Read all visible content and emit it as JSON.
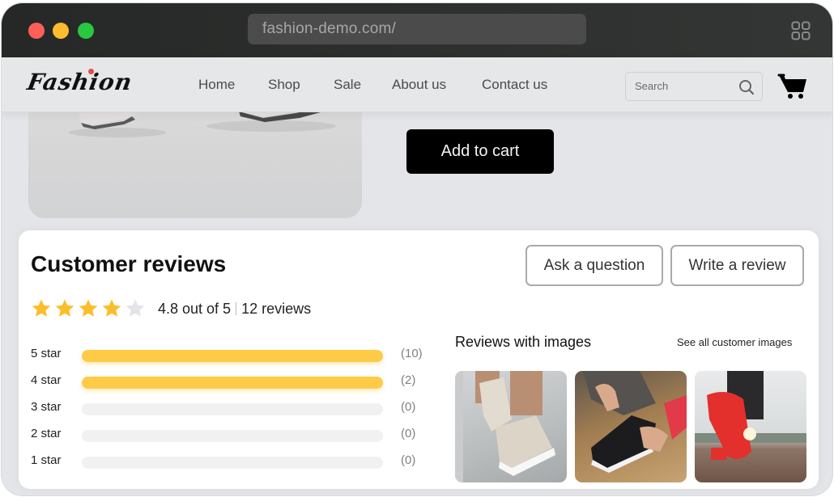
{
  "browser": {
    "url": "fashion-demo.com/",
    "traffic_lights": [
      "close",
      "minimize",
      "maximize"
    ],
    "tabs_icon": "grid-icon"
  },
  "nav": {
    "logo": "Fashion",
    "links": [
      "Home",
      "Shop",
      "Sale",
      "About us",
      "Contact us"
    ],
    "search_placeholder": "Search",
    "search_icon": "search-icon",
    "cart_icon": "cart-icon"
  },
  "product": {
    "add_to_cart_label": "Add to cart"
  },
  "reviews": {
    "title": "Customer reviews",
    "ask_question_label": "Ask a question",
    "write_review_label": "Write a review",
    "rating": 4.8,
    "stars_filled": 4,
    "stars_total": 5,
    "rating_text": "4.8 out of 5",
    "review_count_text": "12 reviews",
    "accent_color": "#fecb47",
    "distribution": [
      {
        "label": "5 star",
        "count_text": "(10)",
        "fill_percent": 100
      },
      {
        "label": "4 star",
        "count_text": "(2)",
        "fill_percent": 100
      },
      {
        "label": "3 star",
        "count_text": "(0)",
        "fill_percent": 0
      },
      {
        "label": "2 star",
        "count_text": "(0)",
        "fill_percent": 0
      },
      {
        "label": "1 star",
        "count_text": "(0)",
        "fill_percent": 0
      }
    ],
    "images_heading": "Reviews with images",
    "see_all_label": "See all customer images",
    "images": [
      {
        "description": "beige platform sneakers on tile floor"
      },
      {
        "description": "person tying black running shoe on wooden deck"
      },
      {
        "description": "red running shoe on track at sunset"
      }
    ]
  }
}
